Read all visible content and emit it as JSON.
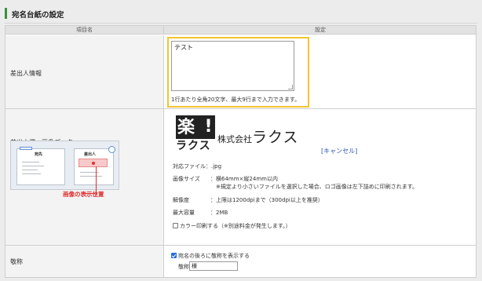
{
  "section": {
    "title": "宛名台紙の設定"
  },
  "table": {
    "col_item": "項目名",
    "col_setting": "設定"
  },
  "sender": {
    "label": "差出人情報",
    "textarea_value": "テスト",
    "note": "1行あたり全角20文字、最大9行まで入力できます。"
  },
  "image_row": {
    "label": "差出人欄　画像データ",
    "logo": {
      "mark": "楽",
      "bang": "!",
      "kana": "ラクス",
      "company_prefix": "株式会社",
      "company_name": "ラクス"
    },
    "cancel_link": "[キャンセル]",
    "illustration": {
      "left_label": "宛先",
      "right_label": "差出人",
      "caption": "画像の表示位置"
    },
    "file_label": "対応ファイル：",
    "file_value": ".jpg",
    "size_label": "画像サイズ",
    "size_value": "：横64mm×縦24mm以内",
    "size_note": "※規定より小さいファイルを選択した場合、ロゴ画像は左下詰めに印刷されます。",
    "resolution_label": "解像度",
    "resolution_value": "：上限は1200dpiまで（300dpi以上を推奨）",
    "max_label": "最大容量",
    "max_value": "：2MB",
    "color_print_label": "カラー印刷する（※別途料金が発生します。）",
    "color_print_checked": false
  },
  "honorific": {
    "label": "敬称",
    "show_label": "宛名の後ろに敬称を表示する",
    "show_checked": true,
    "field_label": "敬称",
    "field_value": "様"
  },
  "colors": {
    "accent_green": "#3a8f3a",
    "highlight_yellow": "#f4c430",
    "link_blue": "#2a55b0",
    "marker_red": "#e03030"
  }
}
